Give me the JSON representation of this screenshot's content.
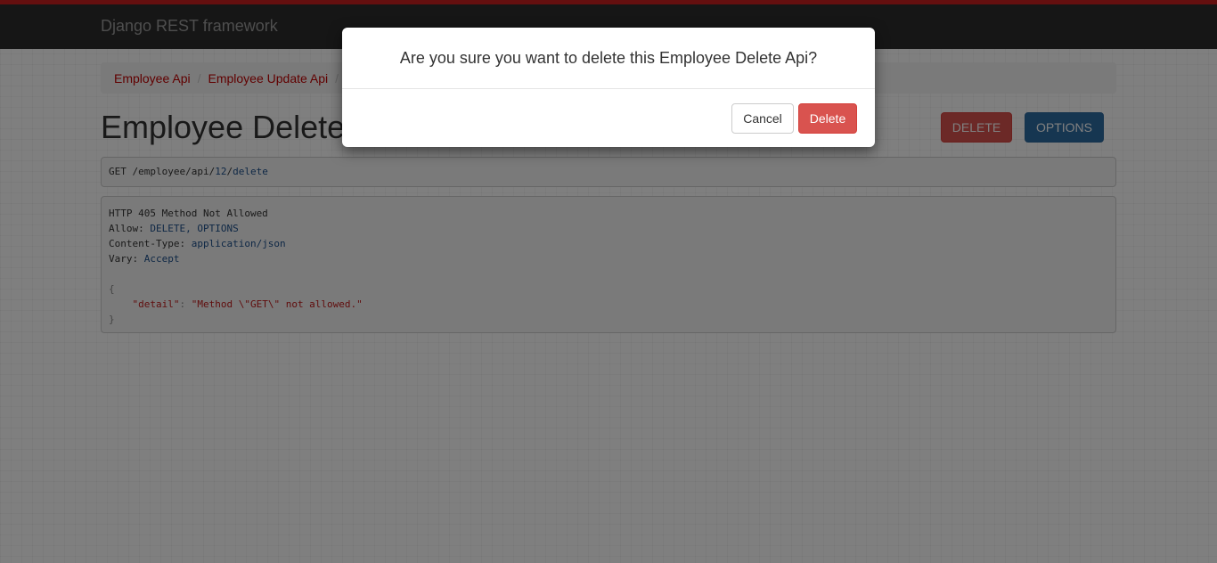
{
  "navbar": {
    "brand": "Django REST framework"
  },
  "breadcrumb": [
    {
      "label": "Employee Api"
    },
    {
      "label": "Employee Update Api"
    }
  ],
  "breadcrumb_separator": "/",
  "page": {
    "title": "Employee Delete Api",
    "actions": {
      "delete_label": "DELETE",
      "options_label": "OPTIONS"
    }
  },
  "request": {
    "method": "GET",
    "path_prefix": "/employee/api/",
    "path_id": "12",
    "path_sep": "/",
    "path_suffix": "delete"
  },
  "response": {
    "status": "HTTP 405 Method Not Allowed",
    "headers": [
      {
        "name": "Allow:",
        "value": "DELETE, OPTIONS"
      },
      {
        "name": "Content-Type:",
        "value": "application/json"
      },
      {
        "name": "Vary:",
        "value": "Accept"
      }
    ],
    "body": {
      "open": "{",
      "key": "\"detail\"",
      "colon": ": ",
      "value": "\"Method \\\"GET\\\" not allowed.\"",
      "close": "}"
    }
  },
  "modal": {
    "title": "Are you sure you want to delete this Employee Delete Api?",
    "cancel_label": "Cancel",
    "delete_label": "Delete"
  },
  "colors": {
    "navbar_bg": "#2c2c2c",
    "navbar_accent": "#c91e1e",
    "link": "#c20000",
    "danger": "#d9534f",
    "primary": "#2d6ca2"
  }
}
